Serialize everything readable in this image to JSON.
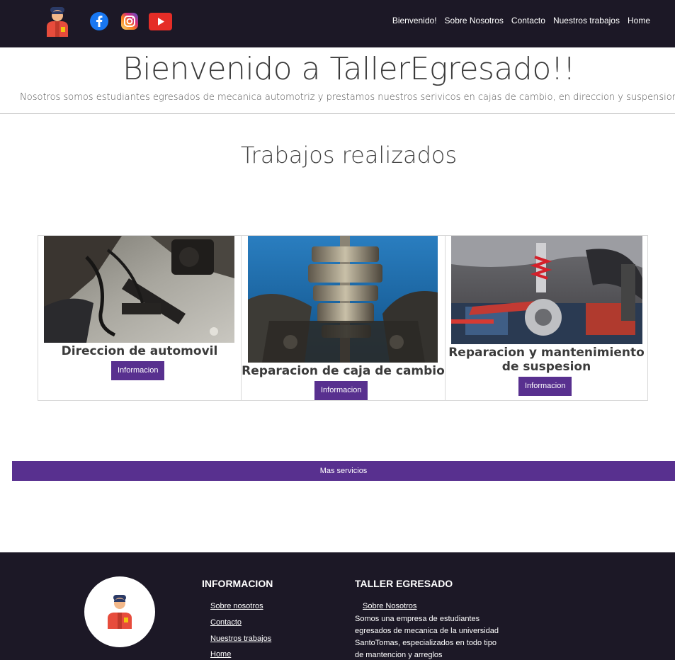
{
  "header": {
    "social_icons": [
      "facebook-icon",
      "instagram-icon",
      "youtube-icon"
    ],
    "nav": [
      "Bienvenido!",
      "Sobre Nosotros",
      "Contacto",
      "Nuestros trabajos",
      "Home"
    ]
  },
  "hero": {
    "title": "Bienvenido a TallerEgresado!!",
    "subtitle": "Nosotros somos estudiantes egresados de mecanica automotriz y prestamos nuestros serivicos en cajas de cambio, en direccion y suspension"
  },
  "works": {
    "title": "Trabajos realizados",
    "cards": [
      {
        "title": "Direccion de automovil",
        "button": "Informacion"
      },
      {
        "title": "Reparacion de caja de cambio",
        "button": "Informacion"
      },
      {
        "title": "Reparacion y mantenimiento de suspesion",
        "button": "Informacion"
      }
    ],
    "more_button": "Mas servicios"
  },
  "footer": {
    "info": {
      "heading": "INFORMACION",
      "links": [
        "Sobre nosotros",
        "Contacto",
        "Nuestros trabajos",
        "Home"
      ]
    },
    "taller": {
      "heading": "TALLER EGRESADO",
      "link": "Sobre Nosotros",
      "text": "Somos una empresa de estudiantes egresados de mecanica de la universidad SantoTomas, especializados en todo tipo de mantencion y arreglos"
    }
  },
  "colors": {
    "header_bg": "#1c1826",
    "accent": "#58308f"
  }
}
